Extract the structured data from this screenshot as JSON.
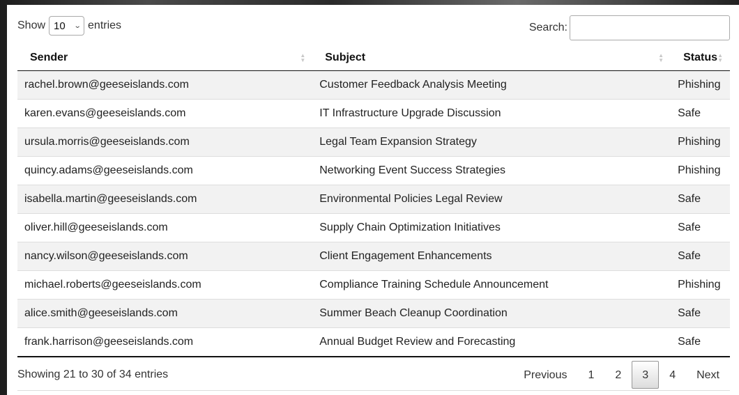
{
  "controls": {
    "show_label": "Show",
    "page_length": "10",
    "entries_label": "entries",
    "search_label": "Search:",
    "search_value": ""
  },
  "table": {
    "headers": {
      "sender": "Sender",
      "subject": "Subject",
      "status": "Status"
    },
    "rows": [
      {
        "sender": "rachel.brown@geeseislands.com",
        "subject": "Customer Feedback Analysis Meeting",
        "status": "Phishing"
      },
      {
        "sender": "karen.evans@geeseislands.com",
        "subject": "IT Infrastructure Upgrade Discussion",
        "status": "Safe"
      },
      {
        "sender": "ursula.morris@geeseislands.com",
        "subject": "Legal Team Expansion Strategy",
        "status": "Phishing"
      },
      {
        "sender": "quincy.adams@geeseislands.com",
        "subject": "Networking Event Success Strategies",
        "status": "Phishing"
      },
      {
        "sender": "isabella.martin@geeseislands.com",
        "subject": "Environmental Policies Legal Review",
        "status": "Safe"
      },
      {
        "sender": "oliver.hill@geeseislands.com",
        "subject": "Supply Chain Optimization Initiatives",
        "status": "Safe"
      },
      {
        "sender": "nancy.wilson@geeseislands.com",
        "subject": "Client Engagement Enhancements",
        "status": "Safe"
      },
      {
        "sender": "michael.roberts@geeseislands.com",
        "subject": "Compliance Training Schedule Announcement",
        "status": "Phishing"
      },
      {
        "sender": "alice.smith@geeseislands.com",
        "subject": "Summer Beach Cleanup Coordination",
        "status": "Safe"
      },
      {
        "sender": "frank.harrison@geeseislands.com",
        "subject": "Annual Budget Review and Forecasting",
        "status": "Safe"
      }
    ]
  },
  "footer": {
    "info": "Showing 21 to 30 of 34 entries"
  },
  "pagination": {
    "previous": "Previous",
    "pages": [
      "1",
      "2",
      "3",
      "4"
    ],
    "current_page": "3",
    "next": "Next"
  },
  "icons": {
    "sort": "sort-arrows-icon",
    "select": "chevron-down-icon"
  }
}
